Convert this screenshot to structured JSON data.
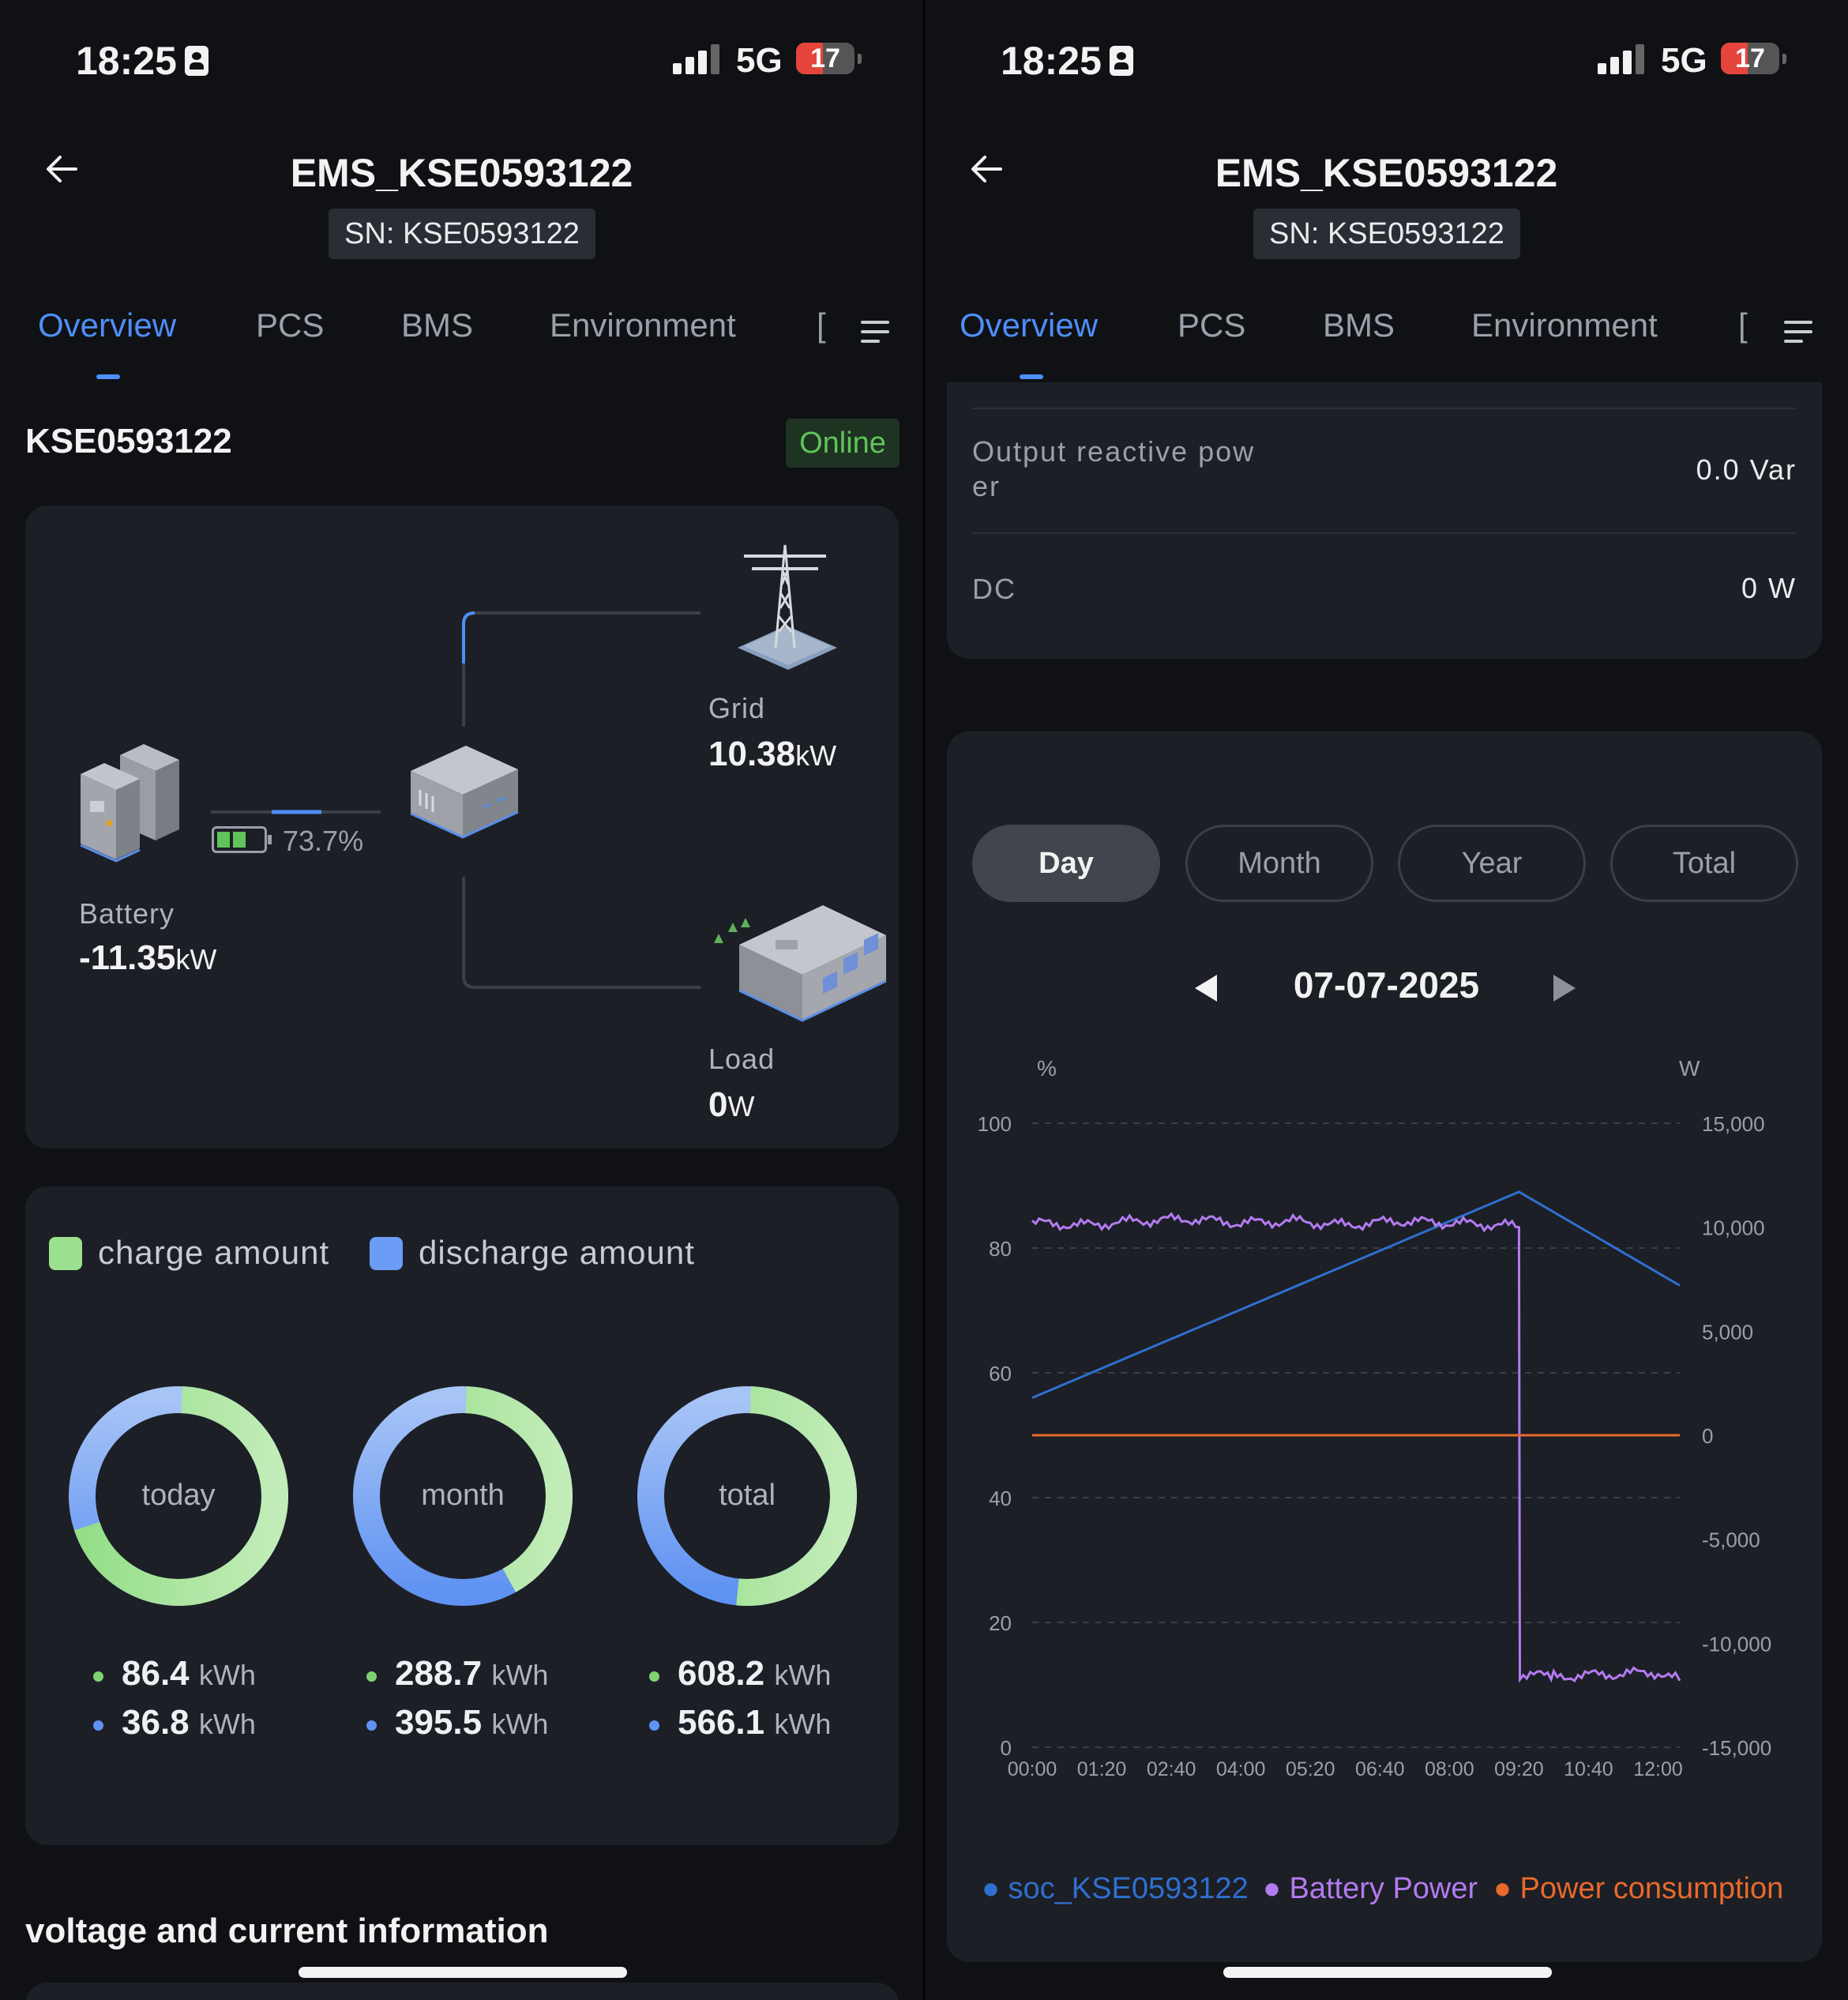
{
  "status": {
    "time": "18:25",
    "network": "5G",
    "battery": "17"
  },
  "header": {
    "title": "EMS_KSE0593122",
    "sn": "SN: KSE0593122"
  },
  "tabs": [
    {
      "label": "Overview",
      "active": true
    },
    {
      "label": "PCS"
    },
    {
      "label": "BMS"
    },
    {
      "label": "Environment"
    },
    {
      "label": "["
    }
  ],
  "icons": {
    "back": "arrow-left-icon",
    "menu": "menu-lines-icon",
    "prev": "triangle-left-icon",
    "next": "triangle-right-icon"
  },
  "device": {
    "id": "KSE0593122",
    "status": "Online"
  },
  "energy_flow": {
    "grid": {
      "label": "Grid",
      "value": "10.38",
      "unit": "kW"
    },
    "battery": {
      "label": "Battery",
      "value": "-11.35",
      "unit": "kW",
      "soc": "73.7%"
    },
    "load": {
      "label": "Load",
      "value": "0",
      "unit": "W"
    }
  },
  "amounts": {
    "legend": {
      "charge": "charge amount",
      "discharge": "discharge amount"
    },
    "colors": {
      "charge": "#9be08e",
      "discharge": "#6b9cf6"
    },
    "donuts": [
      {
        "label": "today",
        "charge": "86.4",
        "discharge": "36.8",
        "unit": "kWh"
      },
      {
        "label": "month",
        "charge": "288.7",
        "discharge": "395.5",
        "unit": "kWh"
      },
      {
        "label": "total",
        "charge": "608.2",
        "discharge": "566.1",
        "unit": "kWh"
      }
    ]
  },
  "section": {
    "voltage_title": "voltage and current information"
  },
  "pcs_rows": [
    {
      "label": "Output reactive pow\ner",
      "value": "0.0 Var"
    },
    {
      "label": "DC",
      "value": "0 W"
    }
  ],
  "period_tabs": [
    {
      "label": "Day",
      "active": true
    },
    {
      "label": "Month"
    },
    {
      "label": "Year"
    },
    {
      "label": "Total"
    }
  ],
  "date": "07-07-2025",
  "chart_data": {
    "type": "line",
    "title": "",
    "xlabel": "",
    "ylabel": "%",
    "y2label": "W",
    "x_ticks": [
      "00:00",
      "01:20",
      "02:40",
      "04:00",
      "05:20",
      "06:40",
      "08:00",
      "09:20",
      "10:40",
      "12:00"
    ],
    "y_ticks": [
      "0",
      "20",
      "40",
      "60",
      "80",
      "100"
    ],
    "y2_ticks": [
      "-15,000",
      "-10,000",
      "-5,000",
      "0",
      "5,000",
      "10,000",
      "15,000"
    ],
    "ylim": [
      0,
      100
    ],
    "y2lim": [
      -15000,
      15000
    ],
    "xlim_minutes": [
      0,
      745
    ],
    "grid": true,
    "legend_position": "bottom",
    "series": [
      {
        "name": "soc_KSE0593122",
        "axis": "left",
        "color": "#2f6fd0",
        "x": [
          "00:00",
          "09:20",
          "12:25"
        ],
        "y": [
          56,
          89,
          74
        ]
      },
      {
        "name": "Battery Power",
        "axis": "right",
        "color": "#b37bf0",
        "x": [
          "00:00",
          "01:00",
          "02:00",
          "03:00",
          "04:00",
          "05:00",
          "06:00",
          "07:00",
          "08:00",
          "09:00",
          "09:20",
          "09:21",
          "10:00",
          "11:00",
          "12:00",
          "12:25"
        ],
        "y": [
          10200,
          10100,
          10300,
          10400,
          10200,
          10300,
          10100,
          10300,
          10200,
          10100,
          10000,
          -11500,
          -11600,
          -11500,
          -11400,
          -11800
        ]
      },
      {
        "name": "Power consumption",
        "axis": "right",
        "color": "#e8692c",
        "x": [
          "00:00",
          "12:25"
        ],
        "y": [
          0,
          0
        ]
      }
    ]
  }
}
